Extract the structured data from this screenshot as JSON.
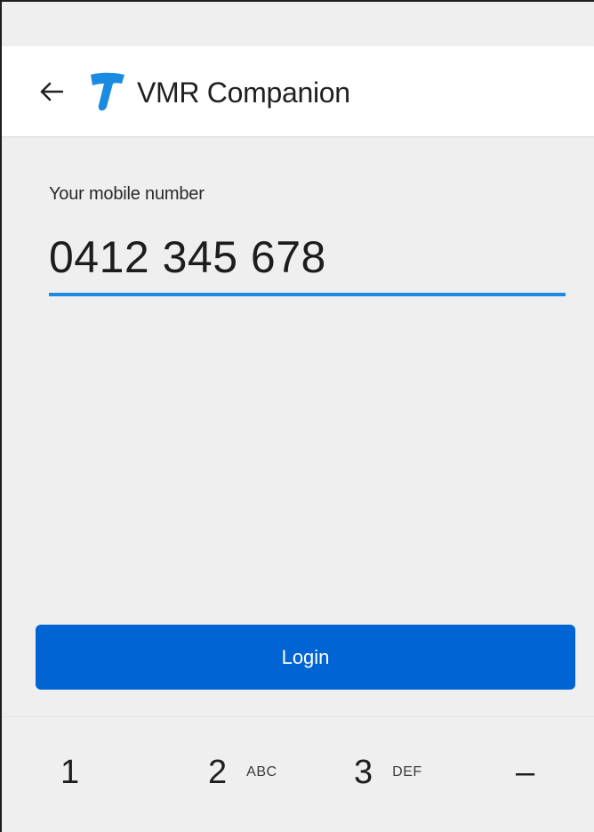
{
  "app_bar": {
    "title": "VMR Companion",
    "back_icon": "arrow-left-icon",
    "logo_icon": "telstra-logo-icon",
    "logo_color": "#1a8be0"
  },
  "form": {
    "label": "Your mobile number",
    "phone_value": "0412 345 678",
    "underline_color": "#1a8be0"
  },
  "login": {
    "label": "Login",
    "color": "#0064d2"
  },
  "keyboard": {
    "keys": [
      {
        "num": "1",
        "letters": ""
      },
      {
        "num": "2",
        "letters": "ABC"
      },
      {
        "num": "3",
        "letters": "DEF"
      },
      {
        "num": "–",
        "letters": ""
      }
    ]
  }
}
